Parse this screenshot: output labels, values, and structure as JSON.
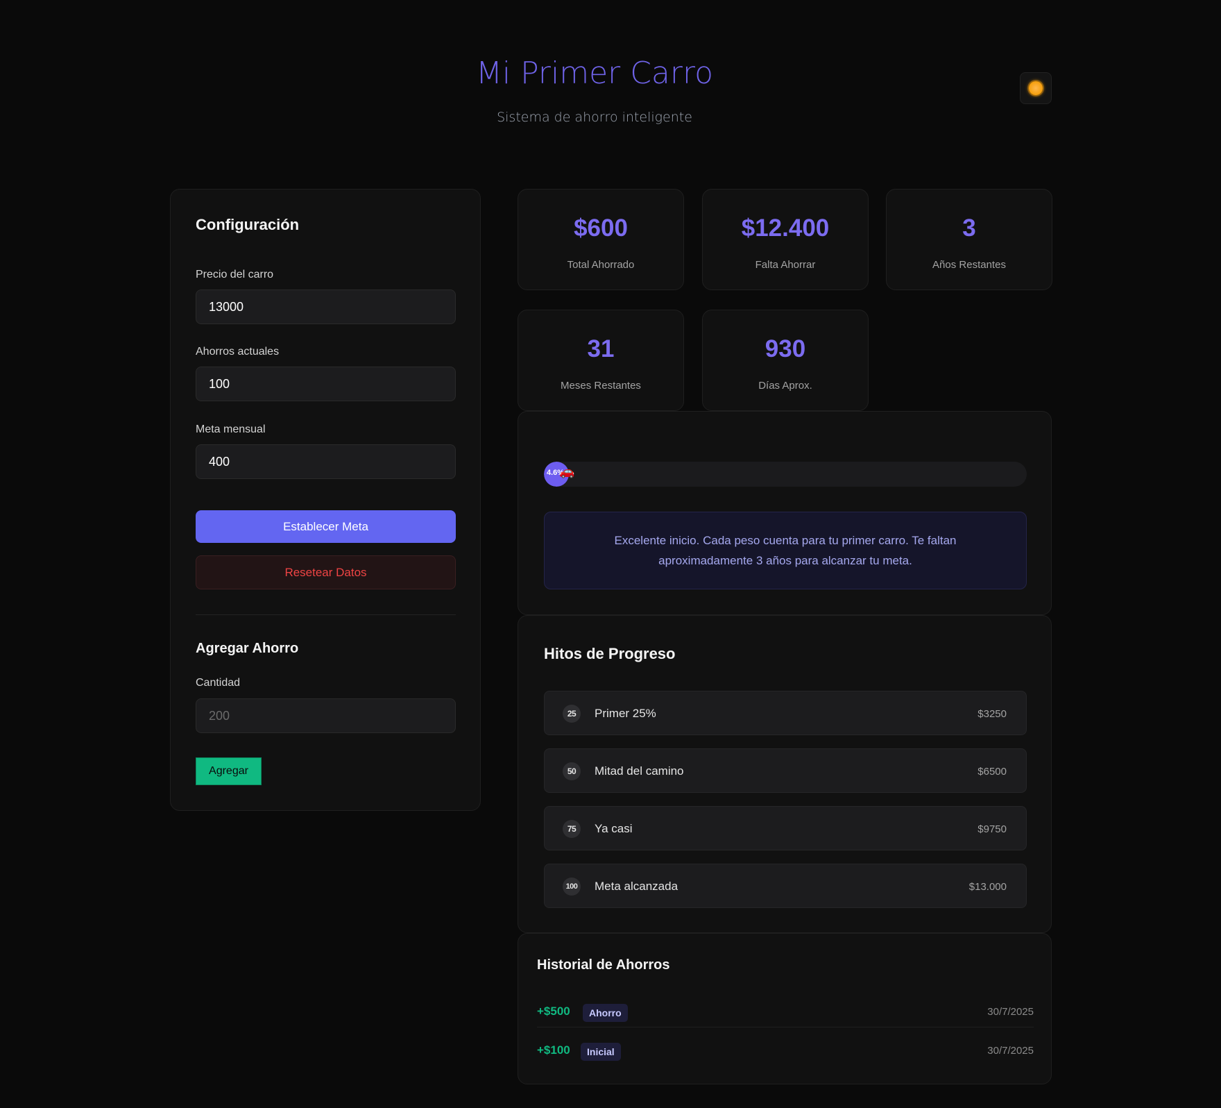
{
  "header": {
    "title": "Mi Primer Carro",
    "subtitle": "Sistema de ahorro inteligente",
    "theme_toggle_icon": "sun-icon"
  },
  "config": {
    "title": "Configuración",
    "price_label": "Precio del carro",
    "price_value": "13000",
    "savings_label": "Ahorros actuales",
    "savings_value": "100",
    "monthly_label": "Meta mensual",
    "monthly_value": "400",
    "set_goal_label": "Establecer Meta",
    "reset_label": "Resetear Datos",
    "add_title": "Agregar Ahorro",
    "amount_label": "Cantidad",
    "amount_placeholder": "200",
    "add_button_label": "Agregar"
  },
  "stats": [
    {
      "value": "$600",
      "label": "Total Ahorrado"
    },
    {
      "value": "$12.400",
      "label": "Falta Ahorrar"
    },
    {
      "value": "3",
      "label": "Años Restantes"
    },
    {
      "value": "31",
      "label": "Meses Restantes"
    },
    {
      "value": "930",
      "label": "Días Aprox."
    }
  ],
  "progress": {
    "percent_text": "4.6%",
    "fraction": 0.046,
    "car_icon": "car-icon",
    "message": "Excelente inicio. Cada peso cuenta para tu primer carro. Te faltan aproximadamente 3 años para alcanzar tu meta."
  },
  "milestones": {
    "title": "Hitos de Progreso",
    "items": [
      {
        "badge": "25",
        "label": "Primer 25%",
        "amount": "$3250"
      },
      {
        "badge": "50",
        "label": "Mitad del camino",
        "amount": "$6500"
      },
      {
        "badge": "75",
        "label": "Ya casi",
        "amount": "$9750"
      },
      {
        "badge": "100",
        "label": "Meta alcanzada",
        "amount": "$13.000"
      }
    ]
  },
  "history": {
    "title": "Historial de Ahorros",
    "items": [
      {
        "amount": "+$500",
        "tag": "Ahorro",
        "date": "30/7/2025"
      },
      {
        "amount": "+$100",
        "tag": "Inicial",
        "date": "30/7/2025"
      }
    ]
  },
  "colors": {
    "accent": "#6366f1",
    "stat_value": "#7c6cf0",
    "success": "#10b981",
    "danger": "#ef4444",
    "background": "#0a0a0a"
  }
}
